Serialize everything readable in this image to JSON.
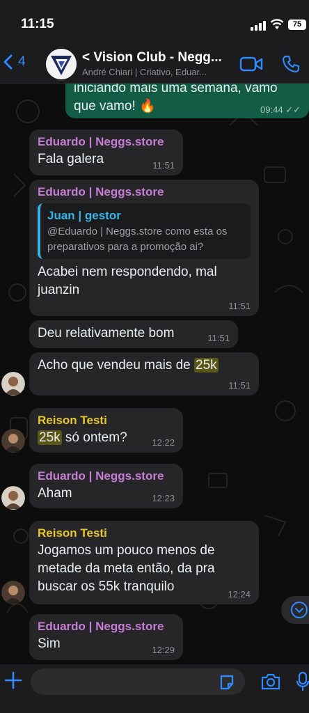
{
  "status": {
    "time": "11:15",
    "battery": "75"
  },
  "header": {
    "back_count": "4",
    "title": "< Vision Club - Negg...",
    "subtitle": "André Chiari | Criativo, Eduar..."
  },
  "messages": [
    {
      "type": "out",
      "text_line1": "iniciando mais uma semana, vamo",
      "text_line2": "que vamo! 🔥",
      "time": "09:44"
    },
    {
      "type": "in",
      "sender": "Eduardo | Neggs.store",
      "text": "Fala galera",
      "time": "11:51"
    },
    {
      "type": "in",
      "sender": "Eduardo | Neggs.store",
      "quote": {
        "name": "Juan | gestor",
        "text": "@Eduardo | Neggs.store como esta os preparativos para a promoção ai?"
      },
      "text": "Acabei nem respondendo, mal juanzin",
      "time": "11:51"
    },
    {
      "type": "in",
      "text": "Deu relativamente bom",
      "time": "11:51"
    },
    {
      "type": "in",
      "text_before": "Acho que vendeu mais de ",
      "highlight": "25k",
      "time": "11:51"
    },
    {
      "type": "in",
      "sender": "Reison Testi",
      "highlight": "25k",
      "text_after": " só ontem?",
      "time": "12:22"
    },
    {
      "type": "in",
      "sender": "Eduardo | Neggs.store",
      "text": "Aham",
      "time": "12:23"
    },
    {
      "type": "in",
      "sender": "Reison Testi",
      "text": "Jogamos um pouco menos de metade da meta então, da pra buscar os 55k tranquilo",
      "time": "12:24"
    },
    {
      "type": "in",
      "sender": "Eduardo | Neggs.store",
      "text": "Sim",
      "time": "12:29"
    }
  ],
  "composer": {
    "placeholder": ""
  },
  "colors": {
    "accent": "#2f8bff",
    "sender_eduardo": "#c77ed8",
    "sender_reison": "#e8c72e",
    "quote_accent": "#35b6e6",
    "outgoing_bubble": "#135c46",
    "incoming_bubble": "#262628"
  }
}
